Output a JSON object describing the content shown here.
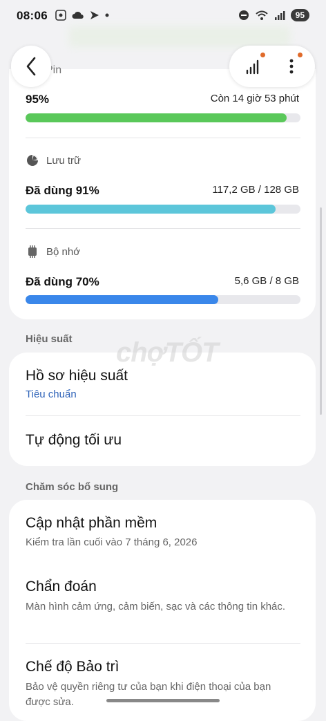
{
  "status_bar": {
    "time": "08:06",
    "wifi_label": "6",
    "battery": "95"
  },
  "header": {
    "partial_title": "Pin",
    "colors": {
      "notification_dot": "#e06a2a"
    }
  },
  "battery": {
    "percent_label": "95%",
    "remaining": "Còn 14 giờ 53 phút",
    "level": 0.95,
    "color": "#5ac85a"
  },
  "storage": {
    "label": "Lưu trữ",
    "used_label": "Đã dùng 91%",
    "amount": "117,2 GB / 128 GB",
    "level": 0.91,
    "color": "#5cc6da"
  },
  "memory": {
    "label": "Bộ nhớ",
    "used_label": "Đã dùng 70%",
    "amount": "5,6 GB / 8 GB",
    "level": 0.7,
    "color": "#3a87ea"
  },
  "performance_section": {
    "header": "Hiệu suất",
    "items": [
      {
        "title": "Hồ sơ hiệu suất",
        "subtitle": "Tiêu chuẩn"
      },
      {
        "title": "Tự động tối ưu"
      }
    ]
  },
  "extra_care_section": {
    "header": "Chăm sóc bổ sung",
    "items": [
      {
        "title": "Cập nhật phần mềm",
        "subtitle": "Kiểm tra lần cuối vào 7 tháng 6, 2026"
      },
      {
        "title": "Chẩn đoán",
        "subtitle": "Màn hình cảm ứng, cảm biến, sạc và các thông tin khác."
      },
      {
        "title": "Chế độ Bảo trì",
        "subtitle": "Bảo vệ quyền riêng tư của bạn khi điện thoại của bạn được sửa."
      }
    ]
  },
  "watermark": "chợTỐT"
}
